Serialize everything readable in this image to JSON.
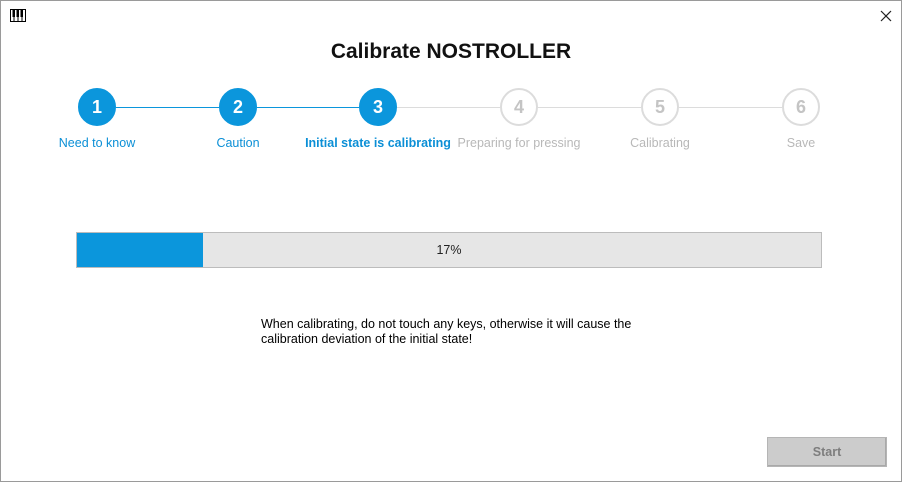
{
  "window": {
    "title": "Calibrate NOSTROLLER",
    "app_icon": "piano-keys-icon",
    "close_icon": "close-icon"
  },
  "colors": {
    "accent": "#0b96dc",
    "inactive_text": "#b8b8b8",
    "inactive_border": "#dcdcdc",
    "progress_track": "#e6e6e6",
    "button_disabled": "#cccccc"
  },
  "steps": [
    {
      "number": "1",
      "label": "Need to know",
      "state": "done"
    },
    {
      "number": "2",
      "label": "Caution",
      "state": "done"
    },
    {
      "number": "3",
      "label": "Initial state is calibrating",
      "state": "current"
    },
    {
      "number": "4",
      "label": "Preparing for pressing",
      "state": "pending"
    },
    {
      "number": "5",
      "label": "Calibrating",
      "state": "pending"
    },
    {
      "number": "6",
      "label": "Save",
      "state": "pending"
    }
  ],
  "progress": {
    "percent": 17,
    "label": "17%"
  },
  "message": "When calibrating, do not touch any keys, otherwise it will cause the calibration deviation of the initial state!",
  "start_button": {
    "label": "Start",
    "enabled": false
  }
}
